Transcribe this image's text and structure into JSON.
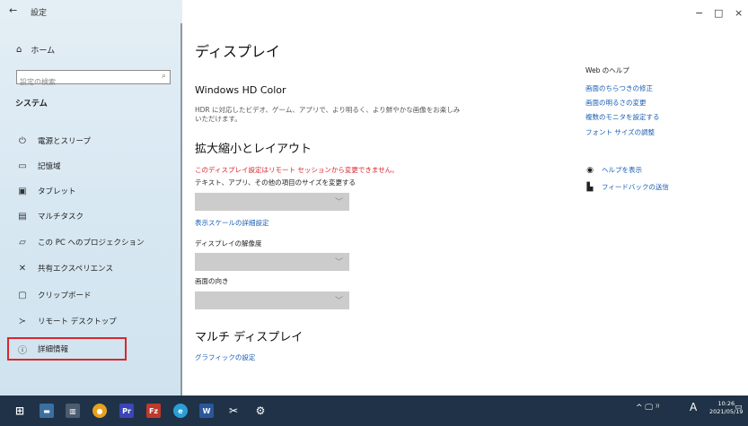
{
  "window": {
    "title": "設定",
    "back_icon": "back-arrow-icon",
    "controls": {
      "minimize": "−",
      "maximize": "□",
      "close": "×"
    }
  },
  "sidebar": {
    "home_label": "ホーム",
    "search_placeholder": "設定の検索",
    "section_title": "システム",
    "items": [
      {
        "icon": "power-icon",
        "glyph": "⏻",
        "label": "電源とスリープ"
      },
      {
        "icon": "storage-icon",
        "glyph": "▭",
        "label": "記憶域"
      },
      {
        "icon": "tablet-icon",
        "glyph": "▣",
        "label": "タブレット"
      },
      {
        "icon": "multitasking-icon",
        "glyph": "▤",
        "label": "マルチタスク"
      },
      {
        "icon": "projecting-icon",
        "glyph": "▱",
        "label": "この PC へのプロジェクション"
      },
      {
        "icon": "shared-experiences-icon",
        "glyph": "✕",
        "label": "共有エクスペリエンス"
      },
      {
        "icon": "clipboard-icon",
        "glyph": "▢",
        "label": "クリップボード"
      },
      {
        "icon": "remote-desktop-icon",
        "glyph": "≻",
        "label": "リモート デスクトップ"
      },
      {
        "icon": "info-icon",
        "glyph": "ⓘ",
        "label": "詳細情報"
      }
    ]
  },
  "main": {
    "page_title": "ディスプレイ",
    "hdr_title": "Windows HD Color",
    "hdr_desc_line1": "HDR に対応したビデオ、ゲーム、アプリで、より明るく、より鮮やかな画像をお楽しみ",
    "hdr_desc_line2": "いただけます。",
    "scale_title": "拡大縮小とレイアウト",
    "remote_warning": "このディスプレイ設定はリモート セッションから変更できません。",
    "text_size_label": "テキスト、アプリ、その他の項目のサイズを変更する",
    "advanced_scaling_link": "表示スケールの詳細設定",
    "resolution_label": "ディスプレイの解像度",
    "orientation_label": "画面の向き",
    "multi_display_title": "マルチ ディスプレイ",
    "graphics_link": "グラフィックの設定"
  },
  "right_panel": {
    "web_help_title": "Web のヘルプ",
    "links": [
      "画面のちらつきの修正",
      "画面の明るさの変更",
      "複数のモニタを設定する",
      "フォント サイズの調整"
    ],
    "get_help": "ヘルプを表示",
    "feedback": "フィードバックの送信"
  },
  "taskbar": {
    "clock_time": "10:26",
    "clock_date": "2021/05/19",
    "ime": "A",
    "tray_icons": "^ 🖵 ⁾⁾ "
  },
  "colors": {
    "accent": "#1a5fb4",
    "warning": "#d9272e",
    "taskbar": "#1f3247",
    "sidebar": "#d8e8f2"
  }
}
